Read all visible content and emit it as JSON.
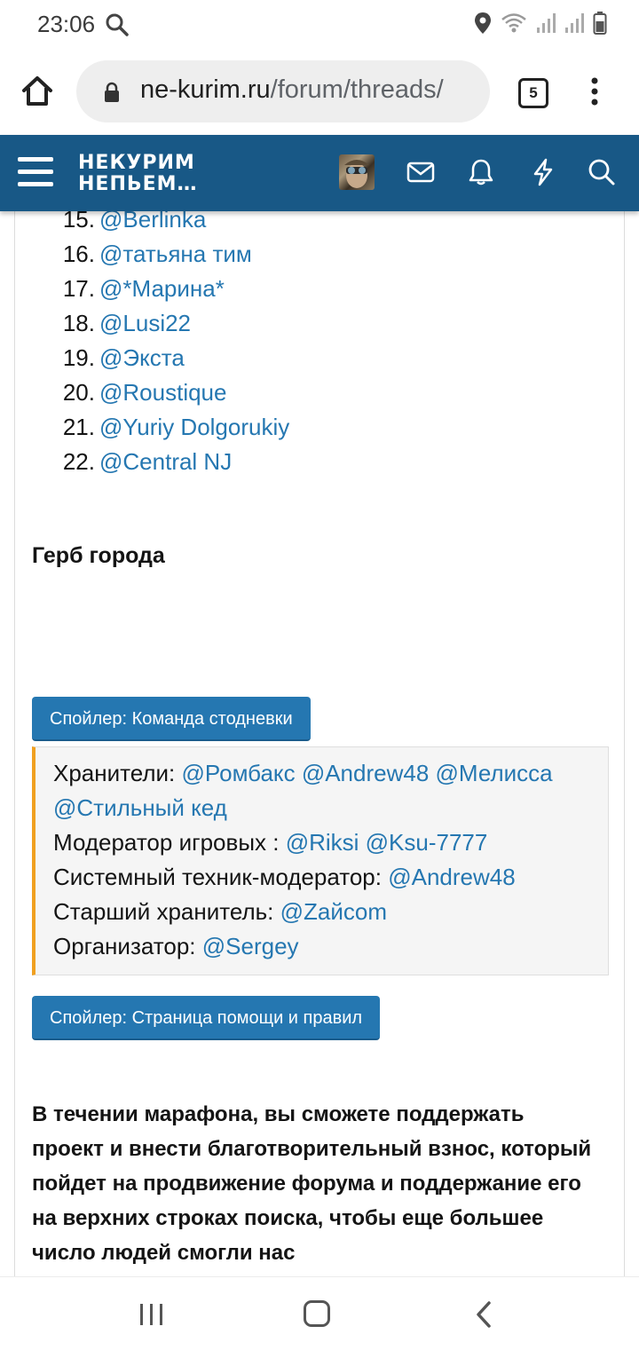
{
  "status_bar": {
    "time": "23:06"
  },
  "browser": {
    "url_domain": "ne-kurim.ru",
    "url_path": "/forum/threads/",
    "tab_count": "5"
  },
  "forum_header": {
    "logo_line1": "НЕКУРИМ",
    "logo_line2": "НЕПЬЕМ…"
  },
  "members_list": [
    {
      "num": "15.",
      "name": "@Berlinka"
    },
    {
      "num": "16.",
      "name": "@татьяна тим"
    },
    {
      "num": "17.",
      "name": "@*Марина*"
    },
    {
      "num": "18.",
      "name": "@Lusi22"
    },
    {
      "num": "19.",
      "name": "@Экста"
    },
    {
      "num": "20.",
      "name": "@Roustique"
    },
    {
      "num": "21.",
      "name": "@Yuriy Dolgorukiy"
    },
    {
      "num": "22.",
      "name": "@Central NJ"
    }
  ],
  "heading": "Герб города",
  "spoiler1": {
    "label": "Спойлер: Команда стодневки",
    "keepers_label": "Хранители:",
    "keepers": [
      "@Ромбакс",
      "@Andrew48",
      "@Мелисса",
      "@Стильный кед"
    ],
    "moderator_label": "Модератор игровых :",
    "moderators": [
      "@Riksi",
      "@Ksu-7777"
    ],
    "tech_label": "Системный техник-модератор:",
    "tech": "@Andrew48",
    "senior_label": "Старший хранитель:",
    "senior": "@Zайсom",
    "organizer_label": "Организатор:",
    "organizer": "@Sergey"
  },
  "spoiler2": {
    "label": "Спойлер: Страница помощи и правил"
  },
  "bold_paragraph": "В течении марафона, вы сможете поддержать проект и внести благотворительный взнос, который пойдет на продвижение форума и поддержание его на верхних строках поиска, чтобы еще большее число людей смогли нас"
}
